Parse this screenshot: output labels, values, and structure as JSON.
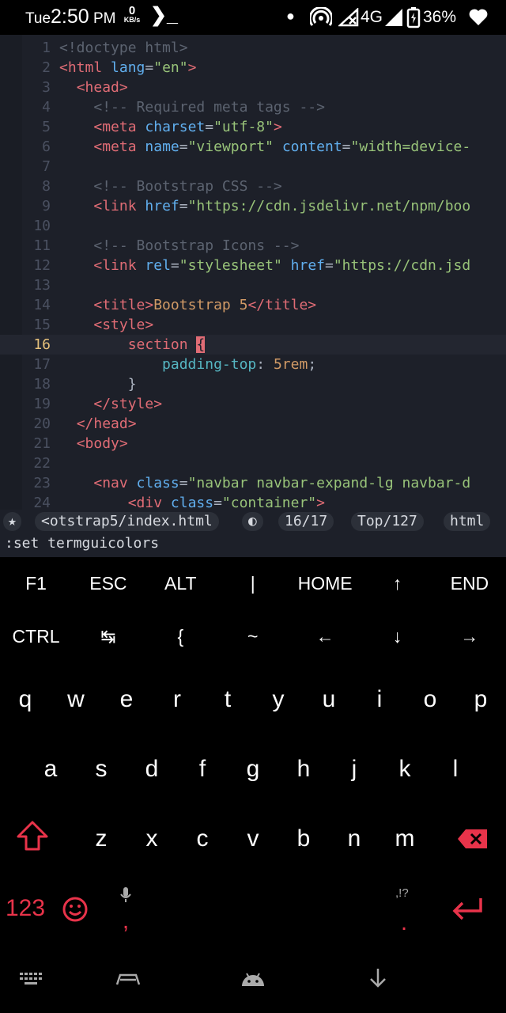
{
  "status_bar": {
    "day": "Tue",
    "time": "2:50",
    "ampm": "PM",
    "speed_value": "0",
    "speed_unit": "KB/s",
    "prompt_glyph": "❯_",
    "network": "4G",
    "battery": "36%"
  },
  "editor": {
    "current_line": 16,
    "lines": [
      {
        "n": "1",
        "tokens": [
          [
            "t-cmt",
            "<!doctype html>"
          ]
        ]
      },
      {
        "n": "2",
        "tokens": [
          [
            "t-tag",
            "<html "
          ],
          [
            "t-attr",
            "lang"
          ],
          [
            "t-plain",
            "="
          ],
          [
            "t-str",
            "\"en\""
          ],
          [
            "t-tag",
            ">"
          ]
        ]
      },
      {
        "n": "3",
        "tokens": [
          [
            "t-plain",
            "  "
          ],
          [
            "t-tag",
            "<head>"
          ]
        ]
      },
      {
        "n": "4",
        "tokens": [
          [
            "t-plain",
            "    "
          ],
          [
            "t-cmt",
            "<!-- Required meta tags -->"
          ]
        ]
      },
      {
        "n": "5",
        "tokens": [
          [
            "t-plain",
            "    "
          ],
          [
            "t-tag",
            "<meta "
          ],
          [
            "t-attr",
            "charset"
          ],
          [
            "t-plain",
            "="
          ],
          [
            "t-str",
            "\"utf-8\""
          ],
          [
            "t-tag",
            ">"
          ]
        ]
      },
      {
        "n": "6",
        "tokens": [
          [
            "t-plain",
            "    "
          ],
          [
            "t-tag",
            "<meta "
          ],
          [
            "t-attr",
            "name"
          ],
          [
            "t-plain",
            "="
          ],
          [
            "t-str",
            "\"viewport\""
          ],
          [
            "t-plain",
            " "
          ],
          [
            "t-attr",
            "content"
          ],
          [
            "t-plain",
            "="
          ],
          [
            "t-str",
            "\"width=device-"
          ]
        ]
      },
      {
        "n": "7",
        "tokens": []
      },
      {
        "n": "8",
        "tokens": [
          [
            "t-plain",
            "    "
          ],
          [
            "t-cmt",
            "<!-- Bootstrap CSS -->"
          ]
        ]
      },
      {
        "n": "9",
        "tokens": [
          [
            "t-plain",
            "    "
          ],
          [
            "t-tag",
            "<link "
          ],
          [
            "t-attr",
            "href"
          ],
          [
            "t-plain",
            "="
          ],
          [
            "t-str",
            "\"https://cdn.jsdelivr.net/npm/boo"
          ]
        ]
      },
      {
        "n": "10",
        "tokens": []
      },
      {
        "n": "11",
        "tokens": [
          [
            "t-plain",
            "    "
          ],
          [
            "t-cmt",
            "<!-- Bootstrap Icons -->"
          ]
        ]
      },
      {
        "n": "12",
        "tokens": [
          [
            "t-plain",
            "    "
          ],
          [
            "t-tag",
            "<link "
          ],
          [
            "t-attr",
            "rel"
          ],
          [
            "t-plain",
            "="
          ],
          [
            "t-str",
            "\"stylesheet\""
          ],
          [
            "t-plain",
            " "
          ],
          [
            "t-attr",
            "href"
          ],
          [
            "t-plain",
            "="
          ],
          [
            "t-str",
            "\"https://cdn.jsd"
          ]
        ]
      },
      {
        "n": "13",
        "tokens": []
      },
      {
        "n": "14",
        "tokens": [
          [
            "t-plain",
            "    "
          ],
          [
            "t-tag",
            "<title>"
          ],
          [
            "t-txt",
            "Bootstrap 5"
          ],
          [
            "t-tag",
            "</title>"
          ]
        ]
      },
      {
        "n": "15",
        "tokens": [
          [
            "t-plain",
            "    "
          ],
          [
            "t-tag",
            "<style>"
          ]
        ]
      },
      {
        "n": "16",
        "tokens": [
          [
            "t-plain",
            "        "
          ],
          [
            "t-sel",
            "section "
          ],
          [
            "cursorblk",
            "{"
          ]
        ]
      },
      {
        "n": "17",
        "tokens": [
          [
            "t-plain",
            "            "
          ],
          [
            "t-prop",
            "padding-top"
          ],
          [
            "t-plain",
            ": "
          ],
          [
            "t-num",
            "5rem"
          ],
          [
            "t-plain",
            ";"
          ]
        ]
      },
      {
        "n": "18",
        "tokens": [
          [
            "t-plain",
            "        }"
          ]
        ]
      },
      {
        "n": "19",
        "tokens": [
          [
            "t-plain",
            "    "
          ],
          [
            "t-tag",
            "</style>"
          ]
        ]
      },
      {
        "n": "20",
        "tokens": [
          [
            "t-plain",
            "  "
          ],
          [
            "t-tag",
            "</head>"
          ]
        ]
      },
      {
        "n": "21",
        "tokens": [
          [
            "t-plain",
            "  "
          ],
          [
            "t-tag",
            "<body>"
          ]
        ]
      },
      {
        "n": "22",
        "tokens": []
      },
      {
        "n": "23",
        "tokens": [
          [
            "t-plain",
            "    "
          ],
          [
            "t-tag",
            "<nav "
          ],
          [
            "t-attr",
            "class"
          ],
          [
            "t-plain",
            "="
          ],
          [
            "t-str",
            "\"navbar navbar-expand-lg navbar-d"
          ]
        ]
      },
      {
        "n": "24",
        "tokens": [
          [
            "t-plain",
            "        "
          ],
          [
            "t-tag",
            "<div "
          ],
          [
            "t-attr",
            "class"
          ],
          [
            "t-plain",
            "="
          ],
          [
            "t-str",
            "\"container\""
          ],
          [
            "t-tag",
            ">"
          ]
        ]
      }
    ]
  },
  "statusline": {
    "mode_icon": "★",
    "filename": "<otstrap5/index.html",
    "misc_icon": "◐",
    "position": "16/17",
    "scroll": "Top/127",
    "filetype": "html"
  },
  "command_line": ":set termguicolors",
  "extra_keys": {
    "row1": [
      "F1",
      "ESC",
      "ALT",
      "|",
      "HOME",
      "↑",
      "END"
    ],
    "row2": [
      "CTRL",
      "↹",
      "{",
      "~",
      "←",
      "↓",
      "→"
    ]
  },
  "keyboard": {
    "row1": [
      "q",
      "w",
      "e",
      "r",
      "t",
      "y",
      "u",
      "i",
      "o",
      "p"
    ],
    "row2": [
      "a",
      "s",
      "d",
      "f",
      "g",
      "h",
      "j",
      "k",
      "l"
    ],
    "row3": [
      "z",
      "x",
      "c",
      "v",
      "b",
      "n",
      "m"
    ],
    "numbers_label": "123",
    "comma": ",",
    "period": ".",
    "punct_hint": ",!?"
  },
  "colors": {
    "editor_bg": "#1d2029",
    "accent_red": "#e8334a",
    "tag": "#e06c75",
    "attr": "#61afef",
    "string": "#98c379"
  }
}
